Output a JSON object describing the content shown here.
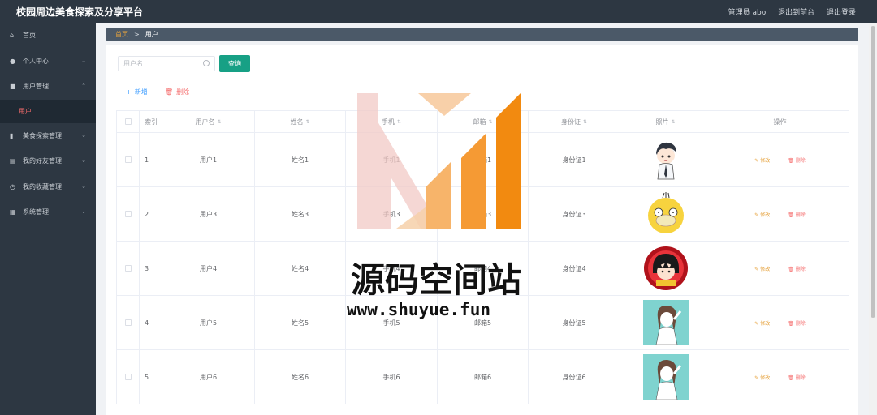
{
  "header": {
    "title": "校园周边美食探索及分享平台",
    "admin_label": "管理员 abo",
    "back_link": "退出到前台",
    "logout_link": "退出登录"
  },
  "sidebar": {
    "items": [
      {
        "icon": "home-icon",
        "label": "首页",
        "has_chevron": false
      },
      {
        "icon": "user-icon",
        "label": "个人中心",
        "has_chevron": true
      },
      {
        "icon": "briefcase-icon",
        "label": "用户管理",
        "has_chevron": true,
        "expanded": true
      },
      {
        "icon": "chart-icon",
        "label": "美食探索管理",
        "has_chevron": true
      },
      {
        "icon": "document-icon",
        "label": "我的好友管理",
        "has_chevron": true
      },
      {
        "icon": "clock-icon",
        "label": "我的收藏管理",
        "has_chevron": true
      },
      {
        "icon": "grid-icon",
        "label": "系统管理",
        "has_chevron": true
      }
    ],
    "sub_item": "用户"
  },
  "breadcrumb": {
    "home": "首页",
    "separator": ">",
    "current": "用户"
  },
  "search": {
    "placeholder": "用户名",
    "button_label": "查询"
  },
  "actions": {
    "add_label": "新增",
    "delete_label": "删除"
  },
  "table": {
    "headers": [
      "索引",
      "用户名",
      "姓名",
      "手机",
      "邮箱",
      "身份证",
      "照片",
      "操作"
    ],
    "rows": [
      {
        "index": "1",
        "username": "用户1",
        "name": "姓名1",
        "phone": "手机1",
        "email": "邮箱1",
        "id_card": "身份证1",
        "photo": "boy-avatar"
      },
      {
        "index": "2",
        "username": "用户3",
        "name": "姓名3",
        "phone": "手机3",
        "email": "邮箱3",
        "id_card": "身份证3",
        "photo": "duck-avatar"
      },
      {
        "index": "3",
        "username": "用户4",
        "name": "姓名4",
        "phone": "手机4",
        "email": "邮箱4",
        "id_card": "身份证4",
        "photo": "girl-red-avatar"
      },
      {
        "index": "4",
        "username": "用户5",
        "name": "姓名5",
        "phone": "手机5",
        "email": "邮箱5",
        "id_card": "身份证5",
        "photo": "girl-sketch-avatar"
      },
      {
        "index": "5",
        "username": "用户6",
        "name": "姓名6",
        "phone": "手机6",
        "email": "邮箱6",
        "id_card": "身份证6",
        "photo": "girl-sketch-avatar"
      }
    ],
    "op_edit": "修改",
    "op_delete": "删除"
  },
  "watermark": {
    "text": "源码空间站",
    "url": "www.shuyue.fun"
  },
  "colors": {
    "topbar": "#2d3742",
    "sidebar_active_text": "#f56c6c",
    "search_button": "#17a085",
    "add_link": "#409eff",
    "delete_link": "#f56c6c",
    "edit_link": "#e6a23c"
  }
}
